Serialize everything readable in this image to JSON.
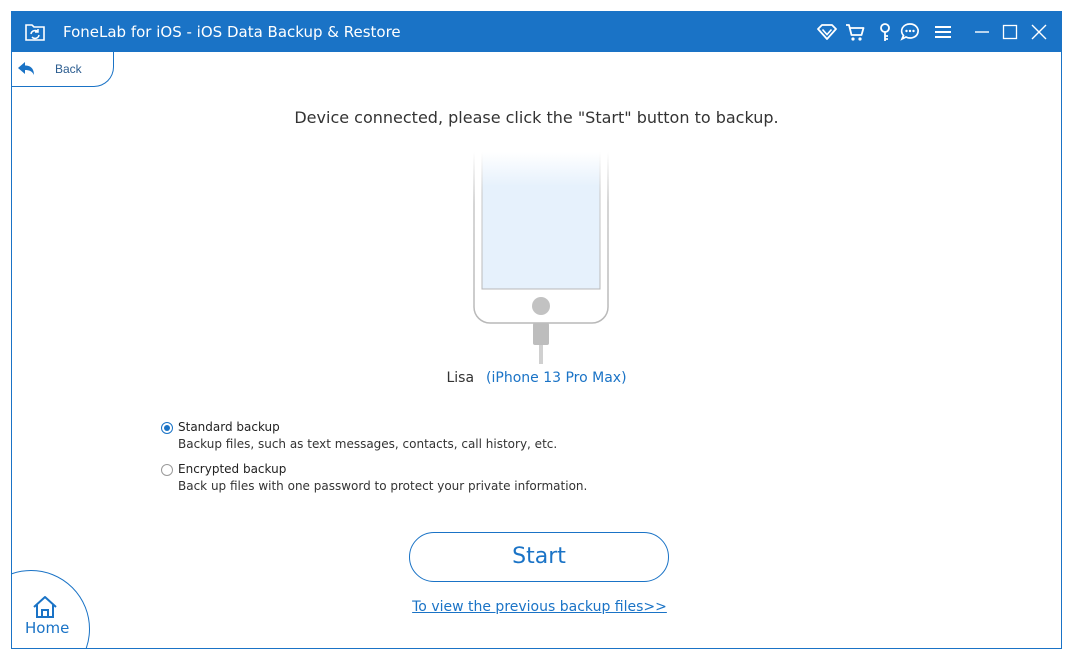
{
  "window": {
    "title": "FoneLab for iOS - iOS Data Backup & Restore",
    "accent_color": "#1a73c6"
  },
  "titlebar_icons": [
    "wifi-icon",
    "cart-icon",
    "key-icon",
    "chat-icon",
    "menu-icon",
    "minimize-icon",
    "maximize-icon",
    "close-icon"
  ],
  "nav": {
    "back_label": "Back",
    "home_label": "Home"
  },
  "main": {
    "prompt": "Device connected, please click the \"Start\" button to backup.",
    "device_owner": "Lisa",
    "device_model": "(iPhone 13 Pro Max)"
  },
  "options": [
    {
      "title": "Standard backup",
      "description": "Backup files, such as text messages, contacts, call history, etc.",
      "selected": true
    },
    {
      "title": "Encrypted backup",
      "description": "Back up files with one password to protect your private information.",
      "selected": false
    }
  ],
  "actions": {
    "start_label": "Start",
    "previous_backups_link": "To view the previous backup files>>"
  }
}
